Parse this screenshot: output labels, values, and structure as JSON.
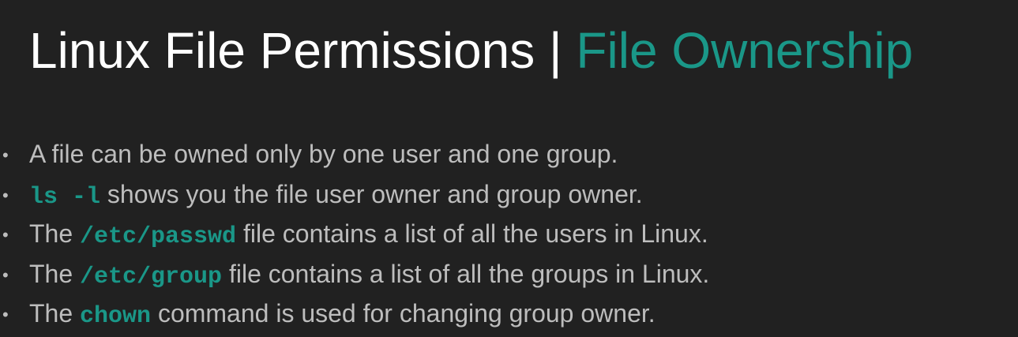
{
  "slide": {
    "title_main": "Linux File Permissions | ",
    "title_accent": "File Ownership",
    "accent_color": "#1a9788",
    "bullets": [
      {
        "before": "",
        "code": "",
        "after": "A file can be owned only by one user and one group."
      },
      {
        "before": "",
        "code": "ls -l",
        "after": " shows you the file user owner and group owner."
      },
      {
        "before": "The ",
        "code": "/etc/passwd",
        "after": " file contains a list of all the users in Linux."
      },
      {
        "before": "The ",
        "code": "/etc/group",
        "after": " file contains a list of all the groups in Linux."
      },
      {
        "before": "The ",
        "code": "chown",
        "after": " command is used for changing group owner."
      }
    ],
    "bullet_marker": "•"
  }
}
